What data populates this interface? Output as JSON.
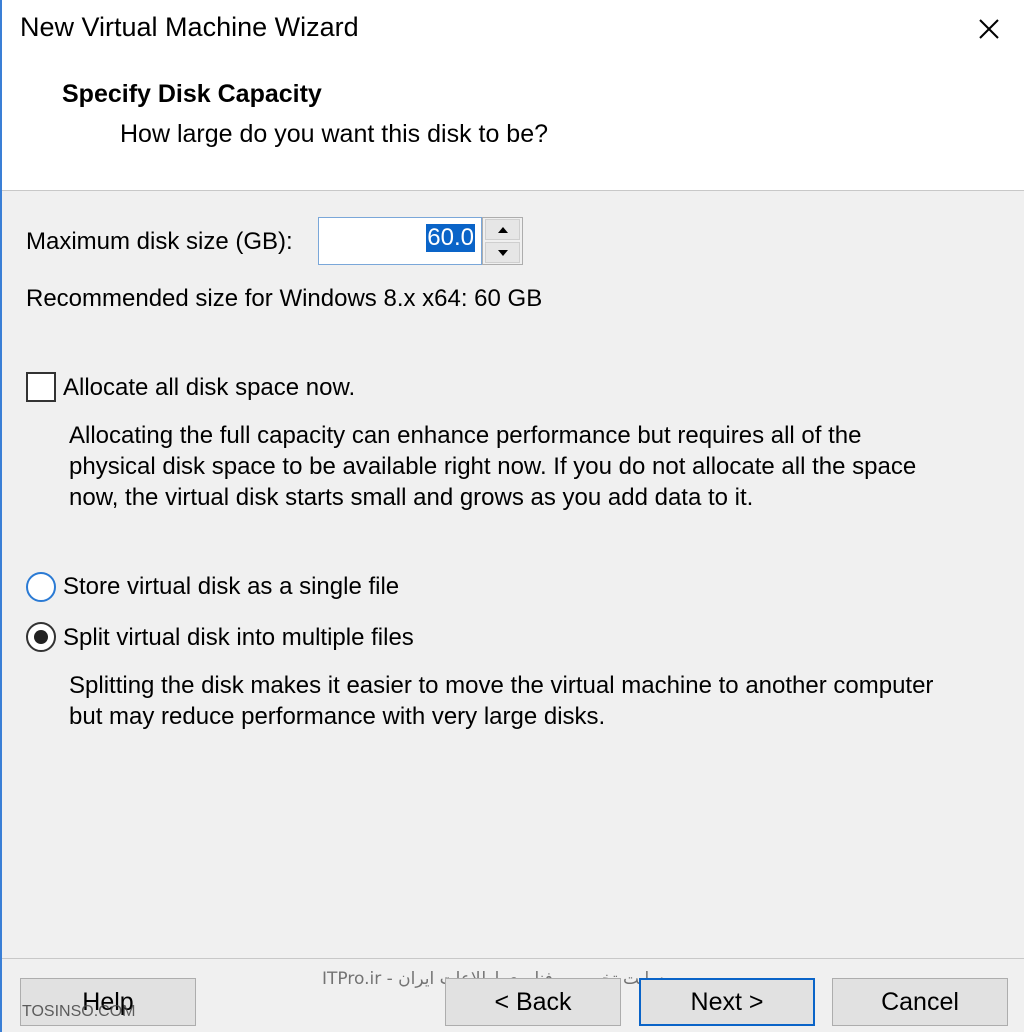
{
  "window": {
    "title": "New Virtual Machine Wizard"
  },
  "header": {
    "title": "Specify Disk Capacity",
    "subtitle": "How large do you want this disk to be?"
  },
  "disk": {
    "max_size_label": "Maximum disk size (GB):",
    "max_size_value": "60.0",
    "recommended": "Recommended size for Windows 8.x x64: 60 GB"
  },
  "allocate": {
    "label": "Allocate all disk space now.",
    "checked": false,
    "desc_lines": [
      "Allocating the full capacity can enhance performance but requires all of the",
      "physical disk space to be available right now. If you do not allocate all the space",
      "now, the virtual disk starts small and grows as you add data to it."
    ]
  },
  "storage": {
    "single_label": "Store virtual disk as a single file",
    "split_label": "Split virtual disk into multiple files",
    "selected": "split",
    "split_desc_lines": [
      "Splitting the disk makes it easier to move the virtual machine to another computer",
      "but may reduce performance with very large disks."
    ]
  },
  "buttons": {
    "help": "Help",
    "back": "< Back",
    "next": "Next >",
    "cancel": "Cancel"
  },
  "watermarks": {
    "persian": "ITPro.ir - وب سایت تخصصی فناوری اطلاعات ایران",
    "site": "TOSINSO.COM"
  },
  "colors": {
    "accent": "#0a64c8",
    "window_border": "#3a7fd6",
    "dialog_bg": "#f0f0f0"
  },
  "icons": {
    "close": "close-icon",
    "spin_up": "triangle-up-icon",
    "spin_down": "triangle-down-icon"
  }
}
